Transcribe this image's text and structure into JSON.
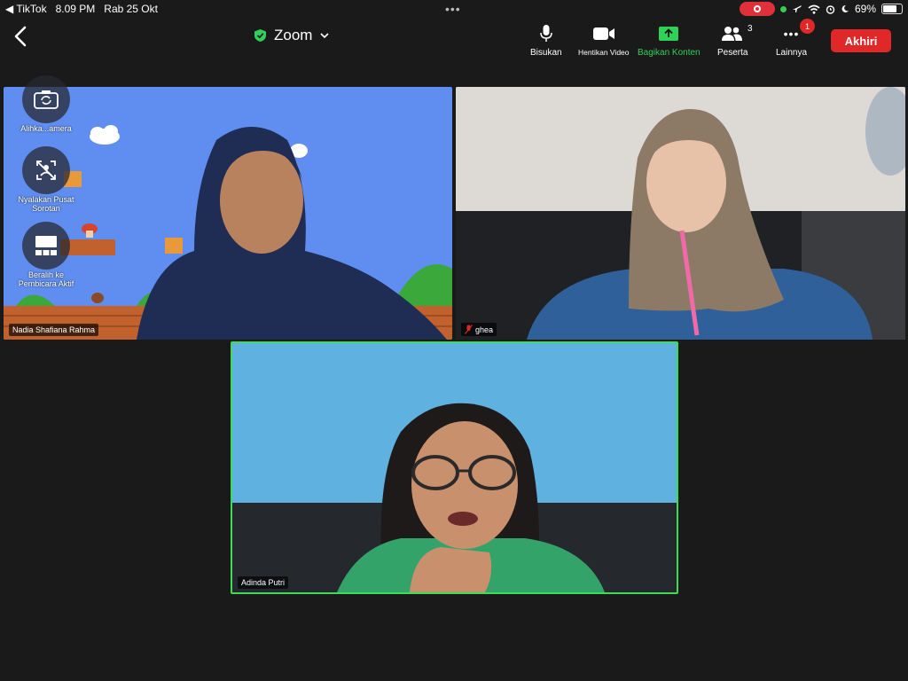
{
  "status_bar": {
    "back_app": "◀ TikTok",
    "time": "8.09 PM",
    "date": "Rab 25 Okt",
    "dots": "•••",
    "battery": "69%"
  },
  "meeting": {
    "title": "Zoom"
  },
  "toolbar": {
    "mute_label": "Bisukan",
    "stop_video_label": "Hentikan Video",
    "share_label": "Bagikan Konten",
    "participants_label": "Peserta",
    "participants_count": "3",
    "more_label": "Lainnya",
    "more_badge": "1",
    "end_label": "Akhiri"
  },
  "side_controls": {
    "switch_camera": "Alihka...amera",
    "center_stage": "Nyalakan Pusat Sorotan",
    "active_speaker": "Beralih ke Pembicara Aktif"
  },
  "participants": [
    {
      "name": "Nadia Shafiana Rahma"
    },
    {
      "name": "ghea",
      "muted": true
    },
    {
      "name": "Adinda Putri",
      "active_speaker": true
    }
  ],
  "colors": {
    "end_button": "#e02828",
    "share_green": "#2fd158",
    "active_border": "#3ddc55",
    "background": "#1a1a1a"
  }
}
